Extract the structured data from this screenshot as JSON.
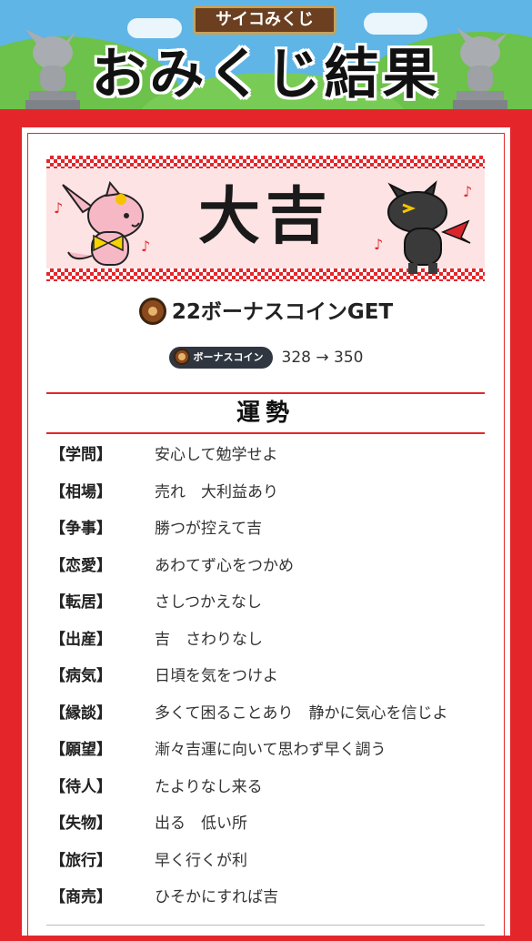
{
  "header": {
    "badge": "サイコみくじ",
    "title": "おみくじ結果"
  },
  "result": {
    "fortune": "大吉",
    "coin_message": "22ボーナスコインGET",
    "coin_label": "ボーナスコイン",
    "balance_change": "328 → 350"
  },
  "section": {
    "title": "運勢"
  },
  "fortune_items": [
    {
      "label": "【学問】",
      "value": "安心して勉学せよ"
    },
    {
      "label": "【相場】",
      "value": "売れ　大利益あり"
    },
    {
      "label": "【争事】",
      "value": "勝つが控えて吉"
    },
    {
      "label": "【恋愛】",
      "value": "あわてず心をつかめ"
    },
    {
      "label": "【転居】",
      "value": "さしつかえなし"
    },
    {
      "label": "【出産】",
      "value": "吉　さわりなし"
    },
    {
      "label": "【病気】",
      "value": "日頃を気をつけよ"
    },
    {
      "label": "【縁談】",
      "value": "多くて困ることあり　静かに気心を信じよ"
    },
    {
      "label": "【願望】",
      "value": "漸々吉運に向いて思わず早く調う"
    },
    {
      "label": "【待人】",
      "value": "たよりなし来る"
    },
    {
      "label": "【失物】",
      "value": "出る　低い所"
    },
    {
      "label": "【旅行】",
      "value": "早く行くが利"
    },
    {
      "label": "【商売】",
      "value": "ひそかにすれば吉"
    }
  ],
  "colors": {
    "accent_red": "#e4262b",
    "sky": "#5fb5e6",
    "grass": "#6cc24a",
    "banner_pink": "#fde3e4"
  },
  "icons": [
    "coin-icon",
    "pink-mascot-icon",
    "black-dragon-mascot-icon",
    "stone-statue-icon",
    "music-note-icon"
  ]
}
